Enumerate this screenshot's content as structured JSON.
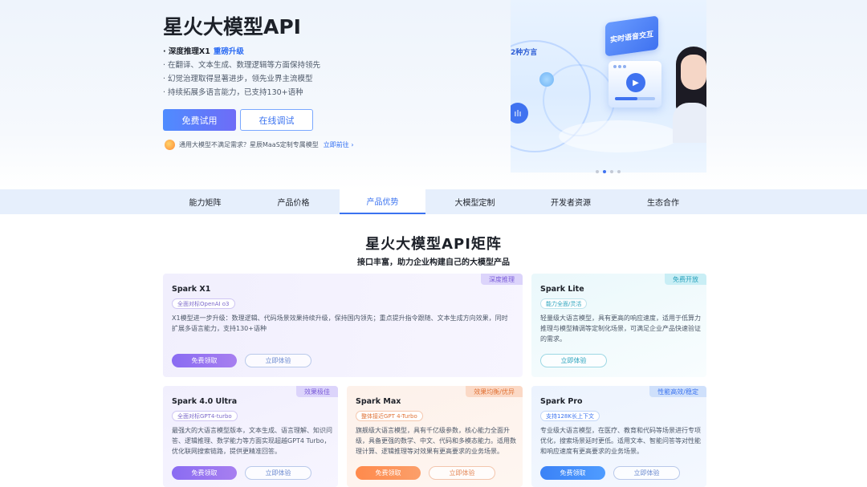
{
  "hero": {
    "title": "星火大模型API",
    "feature1_prefix": "· 深度推理X1",
    "feature1_highlight": "重磅升级",
    "feature2": "· 在翻译、文本生成、数理逻辑等方面保持领先",
    "feature3": "· 幻觉治理取得显著进步，领先业界主流模型",
    "feature4": "· 持续拓展多语言能力，已支持130+语种",
    "btn_primary": "免费试用",
    "btn_outline": "在线调试",
    "promo_text": "通用大模型不满足需求？星辰MaaS定制专属模型",
    "promo_link": "立即前往 ›",
    "illus_tag_voice": "实时语音交互",
    "illus_tag_lang": "2种方言",
    "carousel_active": 2,
    "carousel_total": 4
  },
  "tabs": [
    {
      "label": "能力矩阵"
    },
    {
      "label": "产品价格"
    },
    {
      "label": "产品优势"
    },
    {
      "label": "大模型定制"
    },
    {
      "label": "开发者资源"
    },
    {
      "label": "生态合作"
    }
  ],
  "section": {
    "title": "星火大模型API矩阵",
    "subtitle": "接口丰富，助力企业构建自己的大模型产品"
  },
  "cards": {
    "x1": {
      "badge": "深度推理",
      "name": "Spark X1",
      "chip": "全面对标OpenAI o3",
      "desc": "X1模型进一步升级：数理逻辑、代码场景效果持续升级，保持国内领先；重点提升指令跟随、文本生成方向效果，同时扩展多语言能力，支持130+语种",
      "btn_get": "免费领取",
      "btn_try": "立即体验"
    },
    "lite": {
      "badge": "免费开放",
      "name": "Spark Lite",
      "chip": "能力全面/灵活",
      "desc": "轻量级大语言模型，具有更高的响应速度，适用于低算力推理与模型精调等定制化场景，可满足企业产品快速验证的需求。",
      "btn_try": "立即体验"
    },
    "ultra": {
      "badge": "效果极佳",
      "name": "Spark 4.0 Ultra",
      "chip": "全面对标GPT4-turbo",
      "desc": "最强大的大语言模型版本，文本生成、语言理解、知识问答、逻辑推理、数学能力等方面实现超越GPT4 Turbo，优化联网搜索链路，提供更精准回答。",
      "btn_get": "免费领取",
      "btn_try": "立即体验"
    },
    "max": {
      "badge": "效果均衡/优异",
      "name": "Spark Max",
      "chip": "整体接近GPT 4-Turbo",
      "desc": "旗舰级大语言模型，具有千亿级参数，核心能力全面升级，具备更强的数学、中文、代码和多模态能力。适用数理计算、逻辑推理等对效果有更高要求的业务场景。",
      "btn_get": "免费领取",
      "btn_try": "立即体验"
    },
    "pro": {
      "badge": "性能高效/稳定",
      "name": "Spark Pro",
      "chip": "支持128K长上下文",
      "desc": "专业级大语言模型，在医疗、教育和代码等场景进行专项优化，搜索场景延时更低。适用文本、智能问答等对性能和响应速度有更高要求的业务场景。",
      "btn_get": "免费领取",
      "btn_try": "立即体验"
    }
  }
}
